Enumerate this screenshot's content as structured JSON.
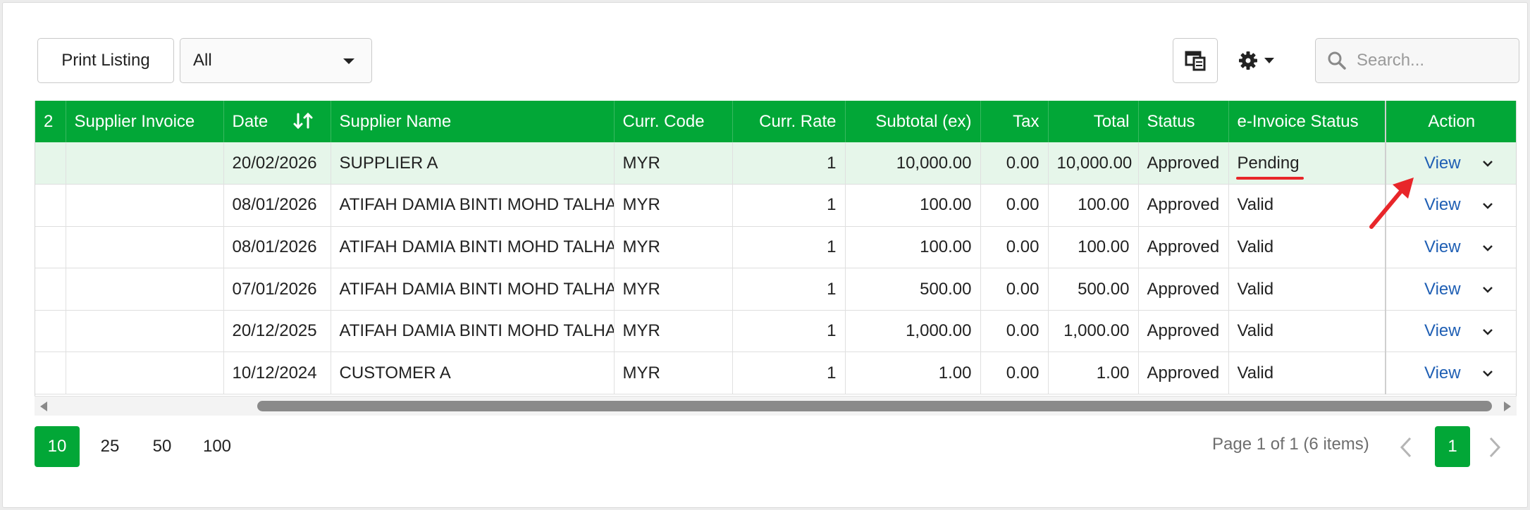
{
  "toolbar": {
    "print_label": "Print Listing",
    "filter_value": "All",
    "search_placeholder": "Search..."
  },
  "grid": {
    "columns": [
      "2",
      "Supplier Invoice",
      "Date",
      "Supplier Name",
      "Curr. Code",
      "Curr. Rate",
      "Subtotal (ex)",
      "Tax",
      "Total",
      "Status",
      "e-Invoice Status",
      "Action"
    ],
    "rows": [
      {
        "col0": "",
        "supplier_invoice": "",
        "date": "20/02/2026",
        "supplier_name": "SUPPLIER A",
        "curr_code": "MYR",
        "curr_rate": "1",
        "subtotal": "10,000.00",
        "tax": "0.00",
        "total": "10,000.00",
        "status": "Approved",
        "einvoice_status": "Pending",
        "action": "View"
      },
      {
        "col0": "",
        "supplier_invoice": "",
        "date": "08/01/2026",
        "supplier_name": "ATIFAH DAMIA BINTI MOHD TALHA",
        "curr_code": "MYR",
        "curr_rate": "1",
        "subtotal": "100.00",
        "tax": "0.00",
        "total": "100.00",
        "status": "Approved",
        "einvoice_status": "Valid",
        "action": "View"
      },
      {
        "col0": "",
        "supplier_invoice": "",
        "date": "08/01/2026",
        "supplier_name": "ATIFAH DAMIA BINTI MOHD TALHA",
        "curr_code": "MYR",
        "curr_rate": "1",
        "subtotal": "100.00",
        "tax": "0.00",
        "total": "100.00",
        "status": "Approved",
        "einvoice_status": "Valid",
        "action": "View"
      },
      {
        "col0": "",
        "supplier_invoice": "",
        "date": "07/01/2026",
        "supplier_name": "ATIFAH DAMIA BINTI MOHD TALHA",
        "curr_code": "MYR",
        "curr_rate": "1",
        "subtotal": "500.00",
        "tax": "0.00",
        "total": "500.00",
        "status": "Approved",
        "einvoice_status": "Valid",
        "action": "View"
      },
      {
        "col0": "",
        "supplier_invoice": "",
        "date": "20/12/2025",
        "supplier_name": "ATIFAH DAMIA BINTI MOHD TALHA",
        "curr_code": "MYR",
        "curr_rate": "1",
        "subtotal": "1,000.00",
        "tax": "0.00",
        "total": "1,000.00",
        "status": "Approved",
        "einvoice_status": "Valid",
        "action": "View"
      },
      {
        "col0": "",
        "supplier_invoice": "",
        "date": "10/12/2024",
        "supplier_name": "CUSTOMER A",
        "curr_code": "MYR",
        "curr_rate": "1",
        "subtotal": "1.00",
        "tax": "0.00",
        "total": "1.00",
        "status": "Approved",
        "einvoice_status": "Valid",
        "action": "View"
      }
    ]
  },
  "pager": {
    "sizes": [
      "10",
      "25",
      "50",
      "100"
    ],
    "active_size": "10",
    "info": "Page 1 of 1 (6 items)",
    "current_page": "1"
  },
  "colors": {
    "accent_green": "#02a737",
    "highlight_row": "#e6f6ea",
    "link_blue": "#1f5fb4",
    "annotation_red": "#e8262a"
  },
  "icons": [
    "caret-down-icon",
    "column-chooser-icon",
    "gear-icon",
    "search-icon",
    "sort-icon",
    "chevron-down-icon",
    "chevron-left-icon",
    "chevron-right-icon",
    "annotation-arrow-icon"
  ]
}
